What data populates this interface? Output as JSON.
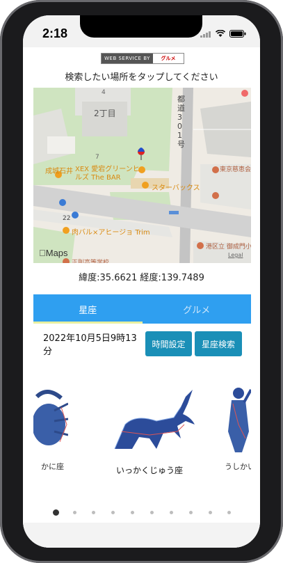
{
  "status": {
    "time": "2:18"
  },
  "banner": {
    "left": "WEB SERVICE BY",
    "right": "グルメ"
  },
  "instruction": "検索したい場所をタップしてください",
  "map": {
    "labels": {
      "district": "2丁目",
      "n4": "4",
      "n7": "7",
      "n22": "22",
      "road": "都道301号",
      "narii": "成城石井",
      "xex": "XEX 愛宕グリーンヒルズ The BAR",
      "starbucks": "スターバックス",
      "jikei": "東京慈恵会医科大学 - 西新橋キャンパス",
      "nikubaru": "肉バル×アヒージョ Trim",
      "minato": "港区立 御成門小学校",
      "school": "正則高等学校",
      "legal": "Legal",
      "maps": "Maps"
    }
  },
  "coords": "緯度:35.6621 経度:139.7489",
  "tabs": [
    {
      "label": "星座",
      "active": true
    },
    {
      "label": "グルメ",
      "active": false
    }
  ],
  "datetime": "2022年10月5日9時13分",
  "buttons": {
    "time_setting": "時間設定",
    "constellation_search": "星座検索"
  },
  "constellations": [
    {
      "name": "かに座"
    },
    {
      "name": "いっかくじゅう座"
    },
    {
      "name": "うしかい座"
    }
  ],
  "pager": {
    "count": 10,
    "active_index": 0
  },
  "colors": {
    "accent": "#2f9ff0",
    "button": "#1a8fb7"
  }
}
